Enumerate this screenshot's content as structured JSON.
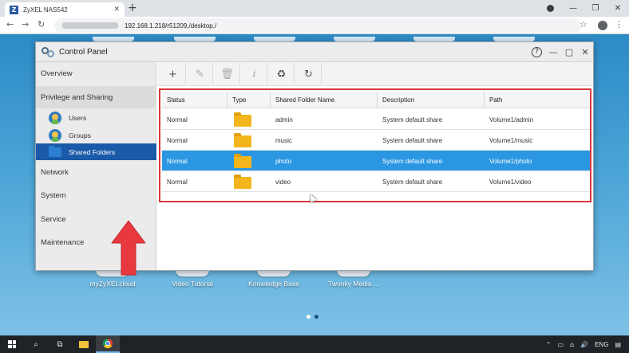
{
  "browser": {
    "tab_title": "ZyXEL NAS542",
    "favicon_letter": "Z",
    "url": "192.168.1.218/r51209,/desktop,/",
    "icons": [
      "close-icon",
      "new-tab-icon",
      "back-icon",
      "forward-icon",
      "reload-icon",
      "star-icon",
      "account-icon",
      "menu-icon",
      "minimize-icon",
      "maximize-icon"
    ]
  },
  "control_panel": {
    "title": "Control Panel",
    "sidebar": {
      "sections": [
        {
          "label": "Overview"
        },
        {
          "label": "Privilege and Sharing"
        },
        {
          "label": "Network"
        },
        {
          "label": "System"
        },
        {
          "label": "Service"
        },
        {
          "label": "Maintenance"
        }
      ],
      "sub_items": [
        {
          "label": "Users",
          "icon": "user-icon"
        },
        {
          "label": "Groups",
          "icon": "group-icon"
        },
        {
          "label": "Shared Folders",
          "icon": "shared-folder-icon",
          "selected": true
        }
      ]
    },
    "toolbar": {
      "buttons": [
        {
          "name": "add",
          "glyph": "+",
          "enabled": true
        },
        {
          "name": "edit",
          "glyph": "✎",
          "enabled": false
        },
        {
          "name": "delete",
          "glyph": "🗑",
          "enabled": false
        },
        {
          "name": "info",
          "glyph": "i",
          "enabled": false
        },
        {
          "name": "recycle",
          "glyph": "♻",
          "enabled": true
        },
        {
          "name": "refresh",
          "glyph": "↻",
          "enabled": true
        }
      ]
    },
    "table": {
      "columns": [
        "Status",
        "Type",
        "Shared Folder Name",
        "Description",
        "Path"
      ],
      "rows": [
        {
          "status": "Normal",
          "name": "admin",
          "description": "System default share",
          "path": "Volume1/admin"
        },
        {
          "status": "Normal",
          "name": "music",
          "description": "System default share",
          "path": "Volume1/music"
        },
        {
          "status": "Normal",
          "name": "photo",
          "description": "System default share",
          "path": "Volume1/photo",
          "selected": true
        },
        {
          "status": "Normal",
          "name": "video",
          "description": "System default share",
          "path": "Volume1/video"
        }
      ]
    }
  },
  "desktop": {
    "icons": [
      {
        "label": "myZyXELcloud"
      },
      {
        "label": "Video Tutorial"
      },
      {
        "label": "Knowledge Base"
      },
      {
        "label": "Twonky Media ..."
      }
    ],
    "pager": {
      "pages": 2,
      "current": 1
    }
  },
  "taskbar": {
    "language": "ENG",
    "colors": {
      "accent": "#76b9ed",
      "selection": "#2b97e3",
      "highlight_frame": "#d9373b",
      "arrow": "#e8393e"
    }
  }
}
